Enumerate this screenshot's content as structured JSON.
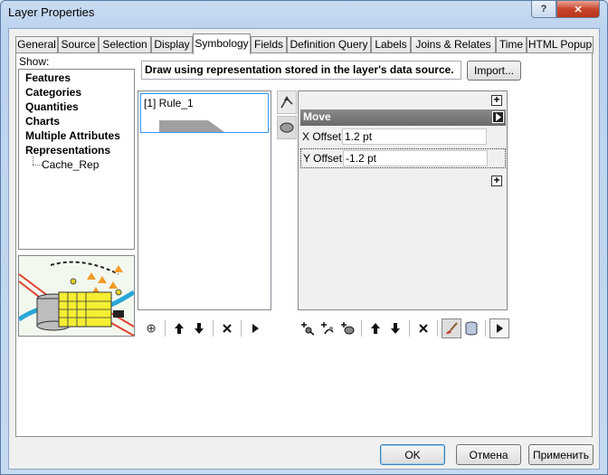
{
  "window": {
    "title": "Layer Properties",
    "help_glyph": "?",
    "close_glyph": "✕"
  },
  "tabs": [
    {
      "label": "General"
    },
    {
      "label": "Source"
    },
    {
      "label": "Selection"
    },
    {
      "label": "Display"
    },
    {
      "label": "Symbology",
      "active": true
    },
    {
      "label": "Fields"
    },
    {
      "label": "Definition Query"
    },
    {
      "label": "Labels"
    },
    {
      "label": "Joins & Relates"
    },
    {
      "label": "Time"
    },
    {
      "label": "HTML Popup"
    }
  ],
  "show": {
    "label": "Show:",
    "items": [
      "Features",
      "Categories",
      "Quantities",
      "Charts",
      "Multiple Attributes",
      "Representations"
    ],
    "subitem": "Cache_Rep",
    "preview_icon": "representation-preview"
  },
  "description": "Draw using representation stored in the layer's data source.",
  "import_label": "Import...",
  "rules": [
    {
      "label": "[1] Rule_1"
    }
  ],
  "properties": {
    "header": "Move",
    "rows": [
      {
        "label": "X Offset:",
        "value": "1.2 pt"
      },
      {
        "label": "Y Offset:",
        "value": "-1.2 pt"
      }
    ]
  },
  "buttons": {
    "ok": "OK",
    "cancel": "Отмена",
    "apply": "Применить"
  },
  "colors": {
    "accent": "#3399ff",
    "header_gray": "#7a7a7a"
  }
}
